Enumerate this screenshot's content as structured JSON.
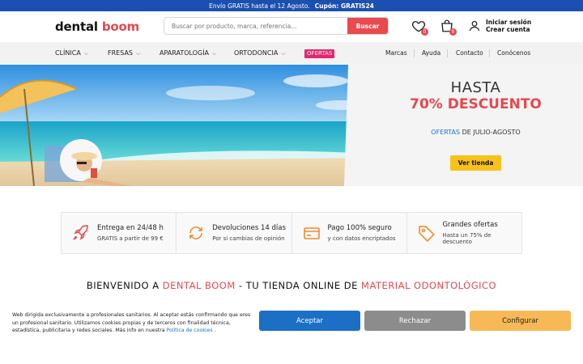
{
  "topbar": {
    "promo": "Envío GRATIS hasta el 12 Agosto.",
    "coupon": "Cupón: GRATIS24"
  },
  "header": {
    "logo_part1": "dental",
    "logo_part2": "boom",
    "search_placeholder": "Buscar por producto, marca, referencia...",
    "search_button": "Buscar",
    "wishlist_count": "0",
    "cart_count": "0",
    "login_line1": "Iniciar sesión",
    "login_line2": "Crear cuenta"
  },
  "nav": {
    "items": [
      "CLÍNICA",
      "FRESAS",
      "APARATOLOGÍA",
      "ORTODONCIA"
    ],
    "ofertas": "OFERTAS",
    "right_links": [
      "Marcas",
      "Ayuda",
      "Contacto",
      "Conócenos"
    ]
  },
  "hero": {
    "line1": "HASTA",
    "line2": "70% DESCUENTO",
    "line3_highlight": "OFERTAS",
    "line3_rest": " DE JULIO-AGOSTO",
    "cta": "Ver tienda"
  },
  "features": [
    {
      "title": "Entrega en 24/48 h",
      "subtitle": "GRATIS a partir de 99 €",
      "icon": "rocket-icon"
    },
    {
      "title": "Devoluciones 14 días",
      "subtitle": "Por si cambias de opinión",
      "icon": "refresh-icon"
    },
    {
      "title": "Pago 100% seguro",
      "subtitle": "y con datos encriptados",
      "icon": "credit-card-icon"
    },
    {
      "title": "Grandes ofertas",
      "subtitle": "Hasta un 75% de descuento",
      "icon": "tag-icon"
    }
  ],
  "welcome": {
    "part1": "BIENVENIDO A ",
    "part2": "DENTAL BOOM",
    "part3": " - TU TIENDA ONLINE DE ",
    "part4": "MATERIAL ODONTOLÓGICO"
  },
  "cookies": {
    "text": "Web dirigida exclusivamente a profesionales sanitarios. Al aceptar estás confirmando que eres un profesional sanitario. Utilizamos cookies propias y de terceros con finalidad técnica, estadística, publicitaria y redes sociales. Más info en nuestra ",
    "link": "Política de cookies",
    "text_end": " .",
    "accept": "Aceptar",
    "reject": "Rechazar",
    "configure": "Configurar"
  },
  "colors": {
    "brand_blue": "#1b4fb0",
    "brand_red": "#e5484d",
    "cta_yellow": "#f7c31b",
    "ofertas_pink": "#e5266a"
  }
}
